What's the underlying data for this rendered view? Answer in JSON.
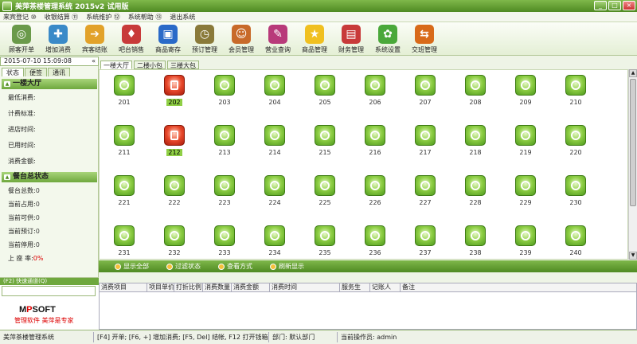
{
  "title": "美萍茶楼管理系统 2015v2 试用版",
  "window_controls": [
    "_",
    "□",
    "×"
  ],
  "menu": [
    "来宾登记 ⑩",
    "收银结算 ⑪",
    "系统维护 ⑫",
    "系统帮助 ⑬",
    "退出系统"
  ],
  "toolbar": [
    {
      "label": "顾客开单",
      "color": "#6a9a4a",
      "glyph": "◎"
    },
    {
      "label": "增加消费",
      "color": "#3a8ac8",
      "glyph": "✚"
    },
    {
      "label": "宾客结账",
      "color": "#e2a22a",
      "glyph": "➔"
    },
    {
      "label": "吧台销售",
      "color": "#c83a3a",
      "glyph": "♦"
    },
    {
      "label": "商品寄存",
      "color": "#2a6ac8",
      "glyph": "▣"
    },
    {
      "label": "预订管理",
      "color": "#8a7a3a",
      "glyph": "◷"
    },
    {
      "label": "会员管理",
      "color": "#c86a2a",
      "glyph": "☺"
    },
    {
      "label": "营业查询",
      "color": "#b83a7a",
      "glyph": "✎"
    },
    {
      "label": "商品管理",
      "color": "#f0c020",
      "glyph": "★"
    },
    {
      "label": "财务管理",
      "color": "#c83a3a",
      "glyph": "▤"
    },
    {
      "label": "系统设置",
      "color": "#4aa83a",
      "glyph": "✿"
    },
    {
      "label": "交班管理",
      "color": "#d86a1a",
      "glyph": "⇆"
    }
  ],
  "datetime": "2015-07-10 15:09:08",
  "datetime_arrow": "«",
  "left_tabs": [
    "状态",
    "便签",
    "通讯"
  ],
  "section1": {
    "title": "一楼大厅",
    "fields": [
      {
        "label": "最低消费:",
        "value": ""
      },
      {
        "label": "计费标准:",
        "value": ""
      },
      {
        "label": "进店时间:",
        "value": ""
      },
      {
        "label": "已用时间:",
        "value": ""
      },
      {
        "label": "消费金额:",
        "value": ""
      }
    ]
  },
  "section2": {
    "title": "餐台总状态",
    "fields": [
      {
        "label": "餐台总数:",
        "value": "0"
      },
      {
        "label": "当前占用:",
        "value": "0"
      },
      {
        "label": "当前可供:",
        "value": "0"
      },
      {
        "label": "当前预订:",
        "value": "0"
      },
      {
        "label": "当前停用:",
        "value": "0"
      },
      {
        "label": "上 座 率:",
        "value": "0%"
      }
    ]
  },
  "quick_entry": "(F2) 快速通道(Q)",
  "logo": {
    "pre": "M",
    "x": "P",
    "post": "SOFT"
  },
  "slogan": "管理软件  美萍是专家",
  "room_tabs": [
    "一楼大厅",
    "二楼小包",
    "三楼大包"
  ],
  "rooms": [
    {
      "id": "201",
      "occupied": false
    },
    {
      "id": "202",
      "occupied": true
    },
    {
      "id": "203",
      "occupied": false
    },
    {
      "id": "204",
      "occupied": false
    },
    {
      "id": "205",
      "occupied": false
    },
    {
      "id": "206",
      "occupied": false
    },
    {
      "id": "207",
      "occupied": false
    },
    {
      "id": "208",
      "occupied": false
    },
    {
      "id": "209",
      "occupied": false
    },
    {
      "id": "210",
      "occupied": false
    },
    {
      "id": "211",
      "occupied": false
    },
    {
      "id": "212",
      "occupied": true
    },
    {
      "id": "213",
      "occupied": false
    },
    {
      "id": "214",
      "occupied": false
    },
    {
      "id": "215",
      "occupied": false
    },
    {
      "id": "216",
      "occupied": false
    },
    {
      "id": "217",
      "occupied": false
    },
    {
      "id": "218",
      "occupied": false
    },
    {
      "id": "219",
      "occupied": false
    },
    {
      "id": "220",
      "occupied": false
    },
    {
      "id": "221",
      "occupied": false
    },
    {
      "id": "222",
      "occupied": false
    },
    {
      "id": "223",
      "occupied": false
    },
    {
      "id": "224",
      "occupied": false
    },
    {
      "id": "225",
      "occupied": false
    },
    {
      "id": "226",
      "occupied": false
    },
    {
      "id": "227",
      "occupied": false
    },
    {
      "id": "228",
      "occupied": false
    },
    {
      "id": "229",
      "occupied": false
    },
    {
      "id": "230",
      "occupied": false
    },
    {
      "id": "231",
      "occupied": false
    },
    {
      "id": "232",
      "occupied": false
    },
    {
      "id": "233",
      "occupied": false
    },
    {
      "id": "234",
      "occupied": false
    },
    {
      "id": "235",
      "occupied": false
    },
    {
      "id": "236",
      "occupied": false
    },
    {
      "id": "237",
      "occupied": false
    },
    {
      "id": "238",
      "occupied": false
    },
    {
      "id": "239",
      "occupied": false
    },
    {
      "id": "240",
      "occupied": false
    }
  ],
  "actions": [
    "显示全部",
    "过滤状态",
    "查看方式",
    "刷新显示"
  ],
  "table_headers": [
    "消费项目",
    "项目单价",
    "打折比例",
    "消费数量",
    "消费金额",
    "消费时间",
    "服务生",
    "记账人",
    "备注"
  ],
  "status": [
    "美萍茶楼管理系统",
    "[F4] 开单; [F6, +] 增加消费; [F5, Del] 结帐, F12 打开钱箱",
    "部门: 默认部门",
    "当前操作员: admin"
  ]
}
